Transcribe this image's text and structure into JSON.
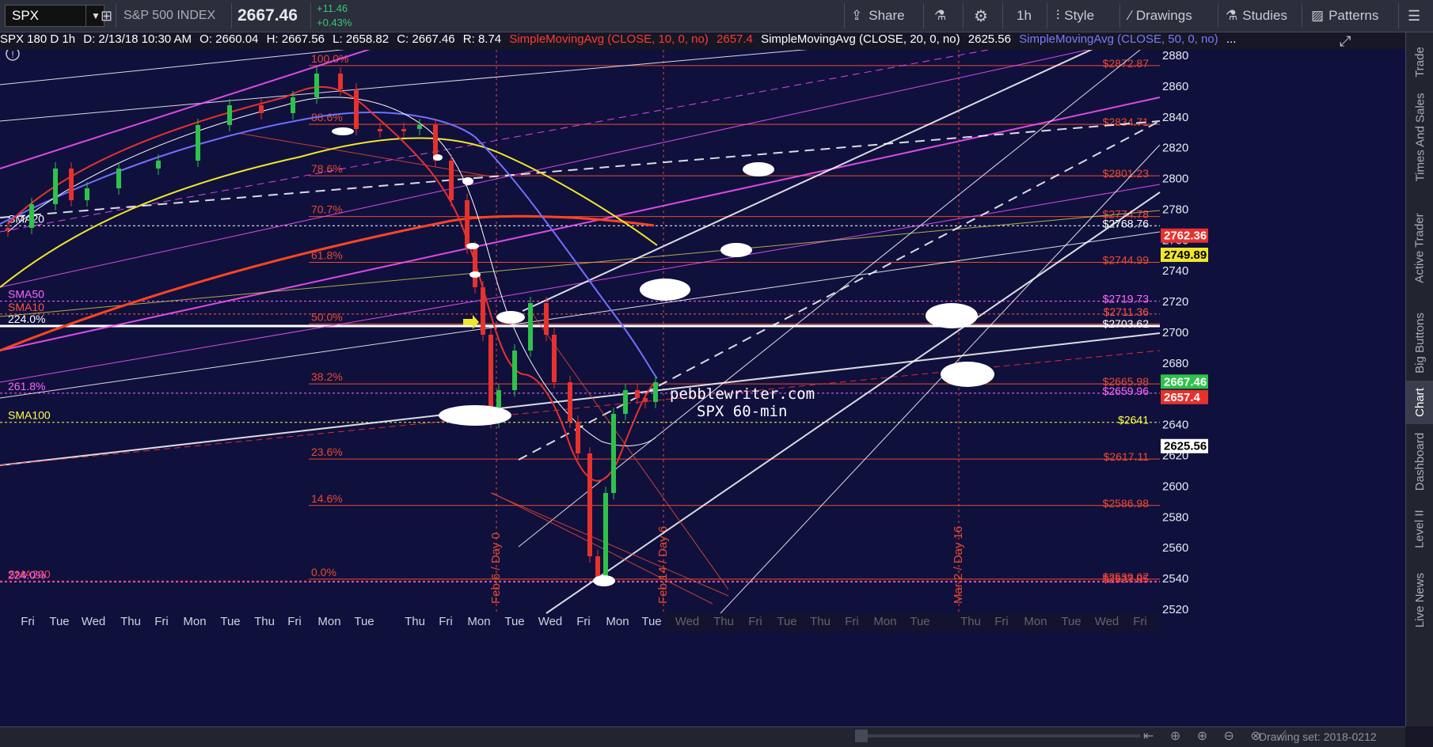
{
  "toolbar": {
    "symbol": "SPX",
    "name": "S&P 500 INDEX",
    "price": "2667.46",
    "change": "+11.46",
    "change_pct": "+0.43%",
    "share": "Share",
    "interval": "1h",
    "style": "Style",
    "drawings": "Drawings",
    "studies": "Studies",
    "patterns": "Patterns",
    "colors": {
      "bg": "#2b2e3b",
      "up": "#37c871"
    }
  },
  "infobar": {
    "title": "SPX 180 D 1h",
    "date": "D: 2/13/18 10:30 AM",
    "open": "O: 2660.04",
    "high": "H: 2667.56",
    "low": "L: 2658.82",
    "close": "C: 2667.46",
    "range": "R: 8.74",
    "sma10": "SimpleMovingAvg (CLOSE, 10, 0, no)",
    "sma10_val": "2657.4",
    "sma20": "SimpleMovingAvg (CLOSE, 20, 0, no)",
    "sma20_val": "2625.56",
    "sma50": "SimpleMovingAvg (CLOSE, 50, 0, no)",
    "ellipsis": "..."
  },
  "right_tabs": [
    "Trade",
    "Times And Sales",
    "Active Trader",
    "Big Buttons",
    "Chart",
    "Dashboard",
    "Level II",
    "Live News"
  ],
  "bottom": {
    "drawing_set": "Drawing set: 2018-0212"
  },
  "chart_data": {
    "type": "candlestick",
    "ylim": [
      2520,
      2890
    ],
    "y_ticks": [
      2520,
      2540,
      2560,
      2580,
      2600,
      2620,
      2640,
      2660,
      2680,
      2700,
      2720,
      2740,
      2760,
      2780,
      2800,
      2820,
      2840,
      2860,
      2880
    ],
    "x_labels": [
      "Fri",
      "Tue",
      "Wed",
      "Thu",
      "Fri",
      "Mon",
      "Tue",
      "Thu",
      "Fri",
      "Mon",
      "Tue",
      "Thu",
      "Fri",
      "Mon",
      "Tue",
      "Wed",
      "Fri",
      "Mon",
      "Tue",
      "Wed",
      "Thu",
      "Fri",
      "Tue",
      "Thu",
      "Fri",
      "Mon",
      "Tue",
      "Thu",
      "Fri",
      "Mon",
      "Tue",
      "Wed",
      "Fri"
    ],
    "fib_levels": [
      {
        "label": "100.0%",
        "price": 2872.87,
        "tag": "$2872.87"
      },
      {
        "label": "88.6%",
        "price": 2834.71,
        "tag": "$2834.71"
      },
      {
        "label": "78.6%",
        "price": 2801.23,
        "tag": "$2801.23"
      },
      {
        "label": "70.7%",
        "price": 2774.78,
        "tag": "$2774.78"
      },
      {
        "label": "61.8%",
        "price": 2744.99,
        "tag": "$2744.99"
      },
      {
        "label": "50.0%",
        "price": 2705.0,
        "tag": ""
      },
      {
        "label": "38.2%",
        "price": 2665.98,
        "tag": "$2665.98"
      },
      {
        "label": "23.6%",
        "price": 2617.11,
        "tag": "$2617.11"
      },
      {
        "label": "14.6%",
        "price": 2586.98,
        "tag": "$2586.98"
      },
      {
        "label": "0.0%",
        "price": 2539.07,
        "tag": "$2539.07"
      }
    ],
    "h_lines": [
      {
        "label": "SMA20",
        "price": 2768.76,
        "tag": "$2768.76",
        "color": "#ffffff"
      },
      {
        "label": "SMA50",
        "price": 2719.73,
        "tag": "$2719.73",
        "color": "#ff66ff"
      },
      {
        "label": "SMA10",
        "price": 2711.36,
        "tag": "$2711.36",
        "color": "#ff5544"
      },
      {
        "label": "224.0%",
        "price": 2703.62,
        "tag": "$2703.62",
        "color": "#ffffff"
      },
      {
        "label": "261.8%",
        "price": 2659.96,
        "tag": "$2659.96",
        "color": "#ff66ff"
      },
      {
        "label": "SMA100",
        "price": 2641,
        "tag": "$2641",
        "color": "#ffff44"
      },
      {
        "label": "SMA200",
        "price": 2537.85,
        "tag": "$2537.85",
        "color": "#ff4444"
      },
      {
        "label": "224.0%",
        "price": 2537.2,
        "tag": "",
        "color": "#ff66ff"
      }
    ],
    "price_tags": [
      {
        "price": 2762.36,
        "text": "2762.36",
        "bg": "#e5322d",
        "fg": "#ffffff"
      },
      {
        "price": 2749.89,
        "text": "2749.89",
        "bg": "#f0e62a",
        "fg": "#000000"
      },
      {
        "price": 2667.46,
        "text": "2667.46",
        "bg": "#2ec24a",
        "fg": "#ffffff"
      },
      {
        "price": 2657.4,
        "text": "2657.4",
        "bg": "#e5322d",
        "fg": "#ffffff"
      },
      {
        "price": 2625.56,
        "text": "2625.56",
        "bg": "#ffffff",
        "fg": "#000000"
      }
    ],
    "vlines": [
      {
        "label": "Feb 6 / Day 0"
      },
      {
        "label": "Feb 14 / Day 6"
      },
      {
        "label": "Mar 2 / Day 16"
      }
    ],
    "watermark": [
      "pebblewriter.com",
      "SPX 60-min"
    ],
    "colors": {
      "background": "#10103d",
      "up": "#2ec24a",
      "down": "#e5322d",
      "sma10": "#e5322d",
      "sma20": "#ffffff",
      "sma50": "#7070ff",
      "sma100": "#f0e62a",
      "sma200": "#ff4422",
      "fib": "#e94a2f",
      "magenta": "#ff55ff"
    }
  }
}
